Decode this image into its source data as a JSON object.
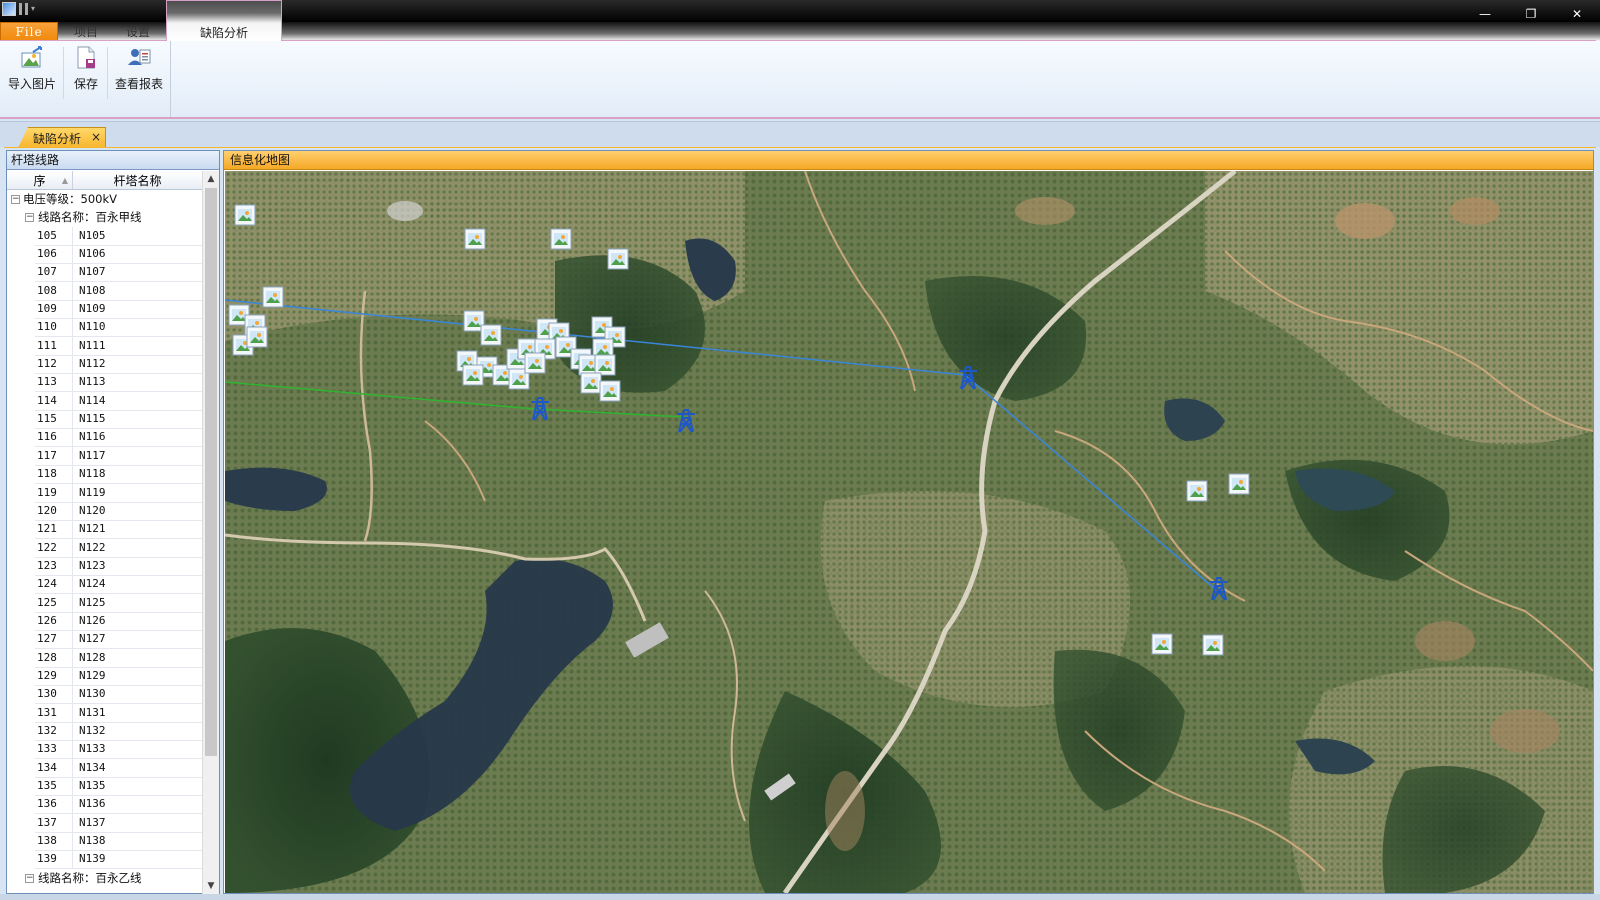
{
  "ribbon": {
    "tabs": [
      {
        "label": "File"
      },
      {
        "label": "项目"
      },
      {
        "label": "设置"
      },
      {
        "label": "缺陷分析"
      }
    ],
    "buttons": [
      {
        "label": "导入图片",
        "icon": "import-image-icon"
      },
      {
        "label": "保存",
        "icon": "save-icon"
      },
      {
        "label": "查看报表",
        "icon": "view-report-icon"
      }
    ]
  },
  "document_tab": {
    "label": "缺陷分析",
    "close": "×"
  },
  "left_panel": {
    "title": "杆塔线路",
    "columns": [
      "序",
      "杆塔名称"
    ],
    "voltage": "电压等级：500kV",
    "line1": "线路名称：百永甲线",
    "line2": "线路名称：百永乙线",
    "rows": [
      [
        "105",
        "N105"
      ],
      [
        "106",
        "N106"
      ],
      [
        "107",
        "N107"
      ],
      [
        "108",
        "N108"
      ],
      [
        "109",
        "N109"
      ],
      [
        "110",
        "N110"
      ],
      [
        "111",
        "N111"
      ],
      [
        "112",
        "N112"
      ],
      [
        "113",
        "N113"
      ],
      [
        "114",
        "N114"
      ],
      [
        "115",
        "N115"
      ],
      [
        "116",
        "N116"
      ],
      [
        "117",
        "N117"
      ],
      [
        "118",
        "N118"
      ],
      [
        "119",
        "N119"
      ],
      [
        "120",
        "N120"
      ],
      [
        "121",
        "N121"
      ],
      [
        "122",
        "N122"
      ],
      [
        "123",
        "N123"
      ],
      [
        "124",
        "N124"
      ],
      [
        "125",
        "N125"
      ],
      [
        "126",
        "N126"
      ],
      [
        "127",
        "N127"
      ],
      [
        "128",
        "N128"
      ],
      [
        "129",
        "N129"
      ],
      [
        "130",
        "N130"
      ],
      [
        "131",
        "N131"
      ],
      [
        "132",
        "N132"
      ],
      [
        "133",
        "N133"
      ],
      [
        "134",
        "N134"
      ],
      [
        "135",
        "N135"
      ],
      [
        "136",
        "N136"
      ],
      [
        "137",
        "N137"
      ],
      [
        "138",
        "N138"
      ],
      [
        "139",
        "N139"
      ]
    ]
  },
  "map_panel": {
    "title": "信息化地图"
  },
  "colors": {
    "accent": "#f6a826",
    "line_blue": "#3a86d8",
    "line_green": "#2fb52f",
    "tower": "#1e57c8"
  }
}
